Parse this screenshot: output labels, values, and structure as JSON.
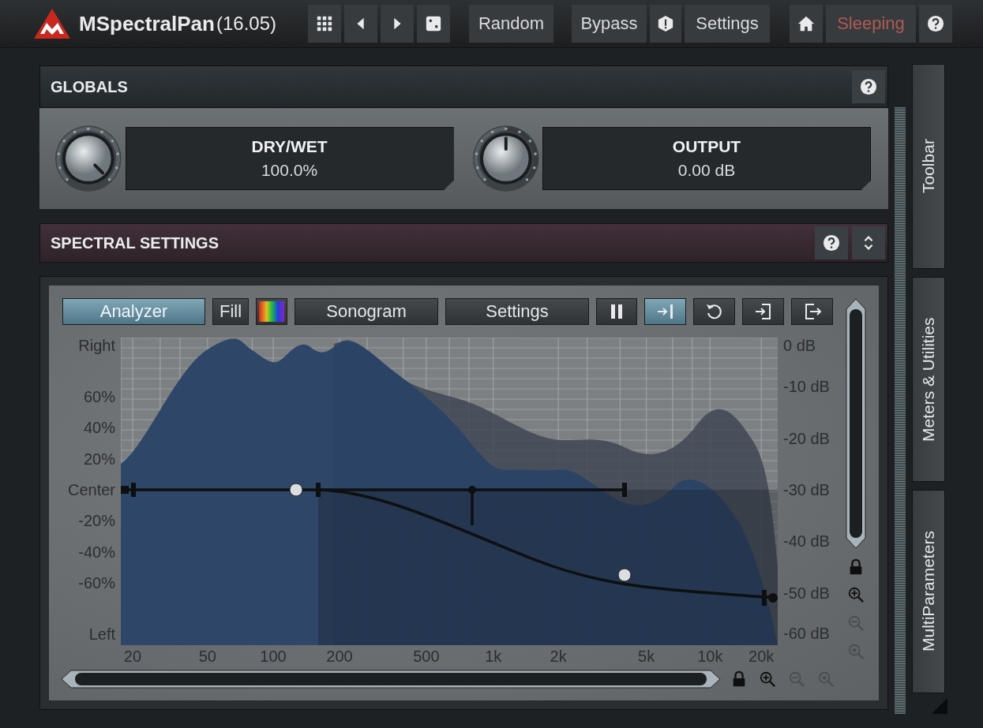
{
  "header": {
    "title": "MSpectralPan",
    "version": "(16.05)",
    "random": "Random",
    "bypass": "Bypass",
    "settings": "Settings",
    "status": "Sleeping"
  },
  "globals": {
    "title": "GLOBALS",
    "knobs": [
      {
        "label": "DRY/WET",
        "value": "100.0%",
        "level": 1.0
      },
      {
        "label": "OUTPUT",
        "value": "0.00 dB",
        "level": 0.5
      }
    ]
  },
  "spectral_settings": {
    "title": "SPECTRAL SETTINGS",
    "expanded": true
  },
  "analyzer": {
    "buttons": [
      {
        "kind": "text",
        "label": "Analyzer",
        "selected": true
      },
      {
        "kind": "text",
        "label": "Fill",
        "selected": false
      },
      {
        "kind": "palette"
      },
      {
        "kind": "text",
        "label": "Sonogram",
        "selected": false
      },
      {
        "kind": "text",
        "label": "Settings",
        "selected": false
      },
      {
        "kind": "pause",
        "selected": false
      },
      {
        "kind": "follow",
        "selected": true
      },
      {
        "kind": "undo"
      },
      {
        "kind": "import"
      },
      {
        "kind": "export"
      }
    ],
    "pan_labels": [
      "Right",
      "60%",
      "40%",
      "20%",
      "Center",
      "-20%",
      "-40%",
      "-60%",
      "Left"
    ],
    "db_labels": [
      "0 dB",
      "-10 dB",
      "-20 dB",
      "-30 dB",
      "-40 dB",
      "-50 dB",
      "-60 dB"
    ],
    "freq_labels": [
      "20",
      "50",
      "100",
      "200",
      "500",
      "1k",
      "2k",
      "5k",
      "10k",
      "20k"
    ]
  },
  "side_tabs": [
    "Toolbar",
    "Meters & Utilities",
    "MultiParameters"
  ]
}
